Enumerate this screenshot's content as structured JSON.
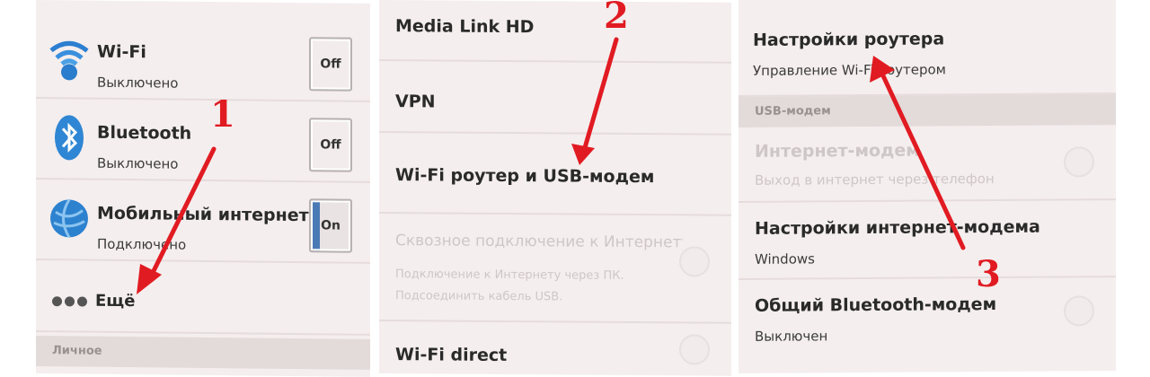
{
  "panel1": {
    "items": [
      {
        "title": "Wi-Fi",
        "subtitle": "Выключено",
        "toggle": "Off"
      },
      {
        "title": "Bluetooth",
        "subtitle": "Выключено",
        "toggle": "Off"
      },
      {
        "title": "Мобильный интернет",
        "subtitle": "Подключено",
        "toggle": "On"
      }
    ],
    "more_label": "Ещё",
    "section_label": "Личное"
  },
  "panel2": {
    "items": [
      {
        "title": "Media Link HD"
      },
      {
        "title": "VPN"
      },
      {
        "title": "Wi-Fi роутер и USB-модем"
      },
      {
        "title": "Сквозное подключение к Интернету",
        "subtitle": "Подключение к Интернету через ПК. Подсоединить кабель USB."
      },
      {
        "title": "Wi-Fi direct"
      }
    ]
  },
  "panel3": {
    "router_title": "Настройки роутера",
    "router_subtitle": "Управление Wi-Fi роутером",
    "section_label": "USB-модем",
    "items": [
      {
        "title": "Интернет-модем",
        "subtitle": "Выход в интернет через телефон"
      },
      {
        "title": "Настройки интернет-модема",
        "subtitle": "Windows"
      },
      {
        "title": "Общий Bluetooth-модем",
        "subtitle": "Выключен"
      }
    ]
  },
  "markers": [
    "1",
    "2",
    "3"
  ],
  "colors": {
    "accent": "#e11b22",
    "toggle_on": "#4a7ab5"
  }
}
